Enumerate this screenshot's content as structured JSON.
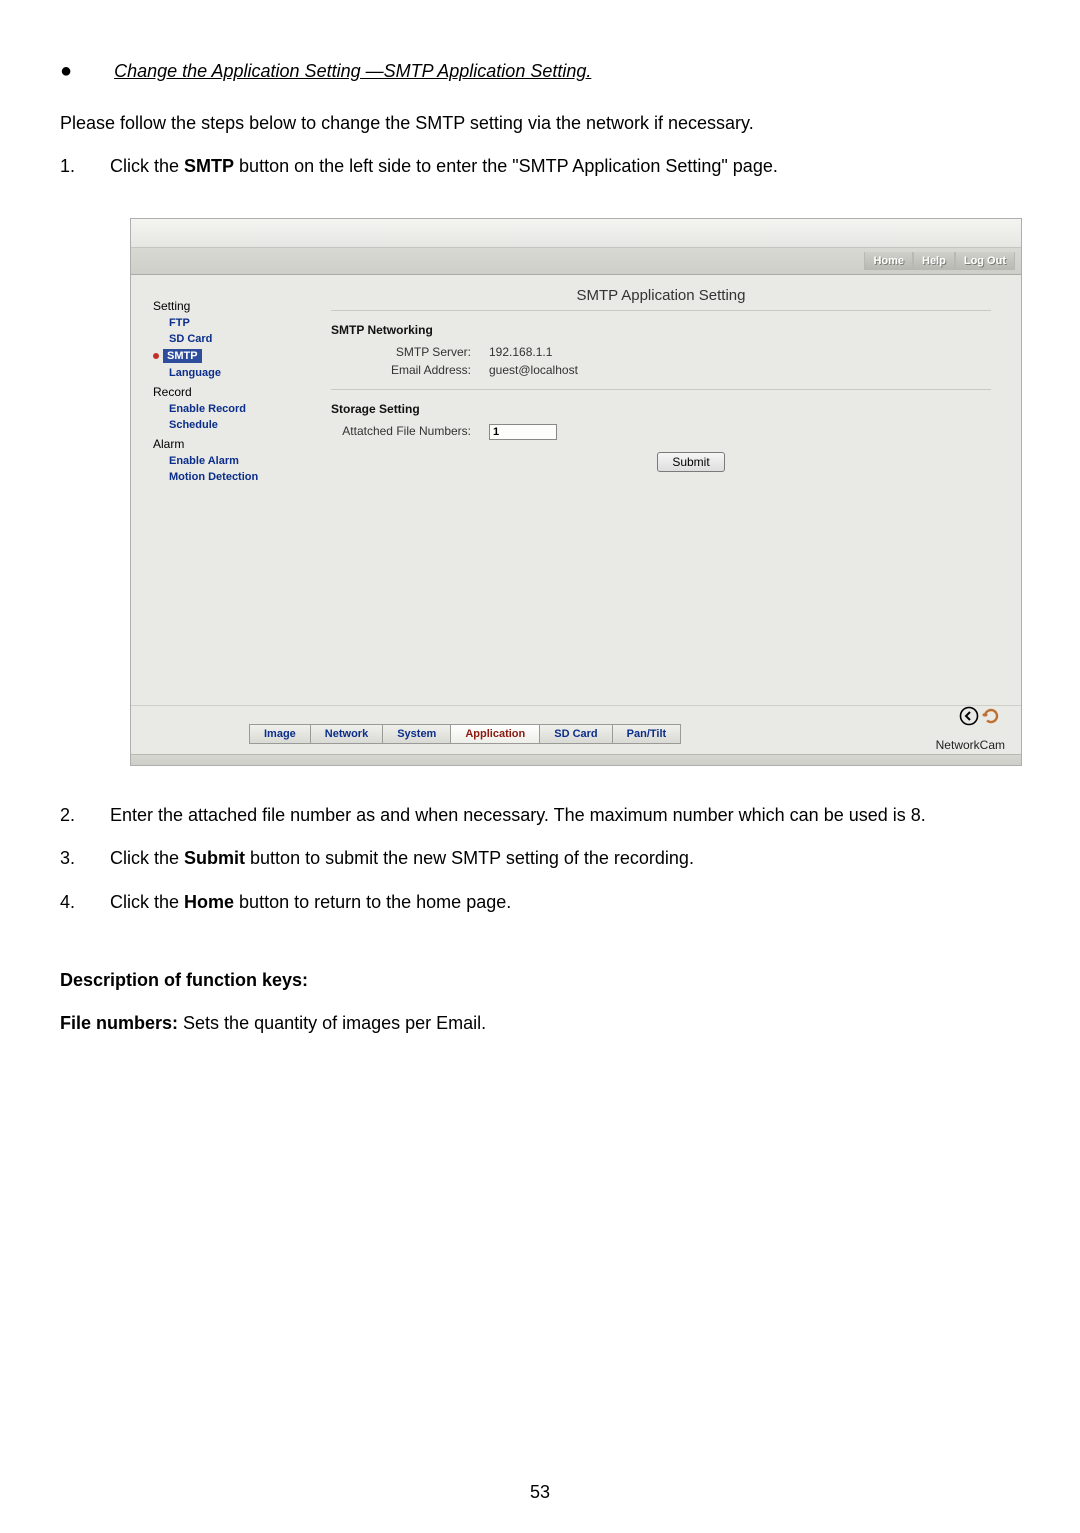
{
  "heading": "Change the Application Setting —SMTP Application Setting.",
  "intro": "Please follow the steps below to change the SMTP setting via the network if necessary.",
  "steps_top": [
    {
      "n": "1.",
      "pre": "Click the ",
      "bold": "SMTP",
      "post": " button on the left side to enter the \"SMTP Application Setting\" page."
    }
  ],
  "steps_bottom": [
    {
      "n": "2.",
      "text": "Enter the attached file number as and when necessary. The maximum number which can be used is 8."
    },
    {
      "n": "3.",
      "pre": "Click the ",
      "bold": "Submit",
      "post": " button to submit the new SMTP setting of the recording."
    },
    {
      "n": "4.",
      "pre": "Click the ",
      "bold": "Home",
      "post": " button to return to the home page."
    }
  ],
  "desc_heading": "Description of function keys:",
  "desc_line_bold": "File numbers:",
  "desc_line_rest": " Sets the quantity of images per Email.",
  "page_number": "53",
  "app": {
    "topbuttons": {
      "home": "Home",
      "help": "Help",
      "logout": "Log Out"
    },
    "title": "SMTP Application Setting",
    "sidebar": {
      "g0": "Setting",
      "i_ftp": "FTP",
      "i_sd": "SD Card",
      "i_smtp": "SMTP",
      "i_lang": "Language",
      "g1": "Record",
      "i_enrec": "Enable Record",
      "i_sched": "Schedule",
      "g2": "Alarm",
      "i_enal": "Enable Alarm",
      "i_motion": "Motion Detection"
    },
    "content": {
      "sec1": "SMTP Networking",
      "l_server": "SMTP Server:",
      "v_server": "192.168.1.1",
      "l_email": "Email Address:",
      "v_email": "guest@localhost",
      "sec2": "Storage Setting",
      "l_attach": "Attatched File Numbers:",
      "v_attach": "1",
      "submit": "Submit"
    },
    "tabs": {
      "image": "Image",
      "network": "Network",
      "system": "System",
      "application": "Application",
      "sdcard": "SD Card",
      "pantilt": "Pan/Tilt"
    },
    "brand": "NetworkCam"
  }
}
